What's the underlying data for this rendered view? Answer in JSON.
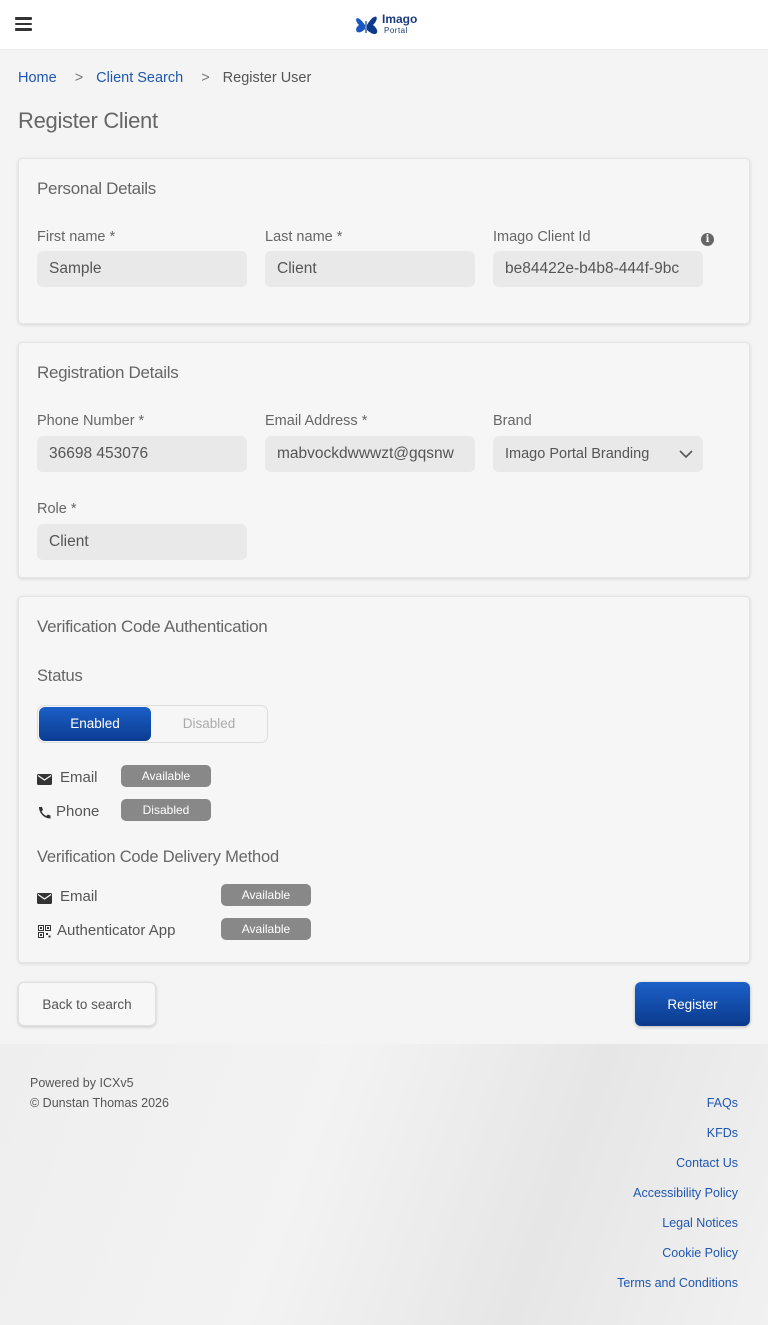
{
  "header": {
    "logo_title": "Imago",
    "logo_subtitle": "Portal"
  },
  "breadcrumb": {
    "home": "Home",
    "sep1": ">",
    "client_search": "Client Search",
    "sep2": ">",
    "current": "Register User"
  },
  "page": {
    "title": "Register Client"
  },
  "personal": {
    "title": "Personal Details",
    "first_name_label": "First name *",
    "first_name_value": "Sample",
    "last_name_label": "Last name *",
    "last_name_value": "Client",
    "client_id_label": "Imago Client Id",
    "client_id_value": "be84422e-b4b8-444f-9bc",
    "info_glyph": "i"
  },
  "registration": {
    "title": "Registration Details",
    "phone_label": "Phone Number *",
    "phone_value": "36698 453076",
    "email_label": "Email Address *",
    "email_value": "mabvockdwwwzt@gqsnw",
    "brand_label": "Brand",
    "brand_value": "Imago Portal Branding",
    "role_label": "Role *",
    "role_value": "Client"
  },
  "verification": {
    "title": "Verification Code Authentication",
    "status_label": "Status",
    "toggle_on": "Enabled",
    "toggle_off": "Disabled",
    "status_rows": [
      {
        "label": "Email",
        "badge": "Available"
      },
      {
        "label": "Phone",
        "badge": "Disabled"
      }
    ],
    "delivery_title": "Verification Code Delivery Method",
    "delivery_rows": [
      {
        "label": "Email",
        "badge": "Available"
      },
      {
        "label": "Authenticator App",
        "badge": "Available"
      }
    ]
  },
  "actions": {
    "back_label": "Back to search",
    "register_label": "Register"
  },
  "footer": {
    "powered": "Powered by ICXv5",
    "copyright": "© Dunstan Thomas 2026",
    "links": [
      "FAQs",
      "KFDs",
      "Contact Us",
      "Accessibility Policy",
      "Legal Notices",
      "Cookie Policy",
      "Terms and Conditions"
    ]
  },
  "colors": {
    "accent": "#0b3c91",
    "link": "#1e56b0",
    "badge": "#888888"
  }
}
